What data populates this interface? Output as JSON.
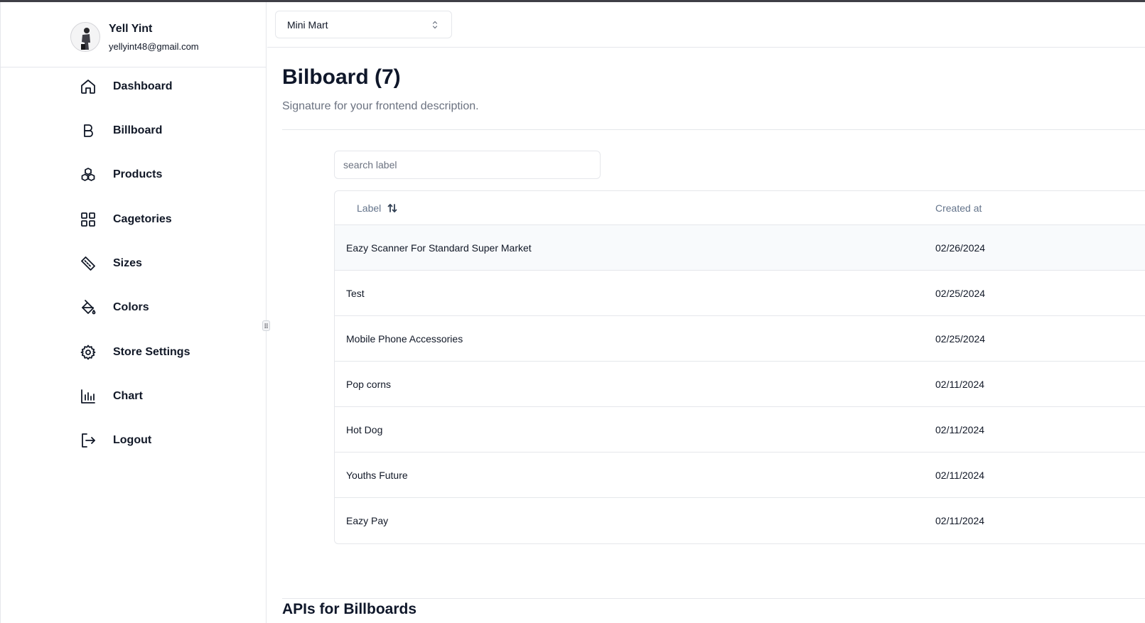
{
  "user": {
    "name": "Yell Yint",
    "email": "yellyint48@gmail.com"
  },
  "sidebar": {
    "items": [
      {
        "label": "Dashboard",
        "icon": "home-icon"
      },
      {
        "label": "Billboard",
        "icon": "bold-b-icon"
      },
      {
        "label": "Products",
        "icon": "boxes-icon"
      },
      {
        "label": "Cagetories",
        "icon": "grid-icon"
      },
      {
        "label": "Sizes",
        "icon": "ruler-icon"
      },
      {
        "label": "Colors",
        "icon": "paint-bucket-icon"
      },
      {
        "label": "Store Settings",
        "icon": "gear-icon"
      },
      {
        "label": "Chart",
        "icon": "bar-chart-icon"
      },
      {
        "label": "Logout",
        "icon": "logout-icon"
      }
    ]
  },
  "header": {
    "store": "Mini Mart"
  },
  "page": {
    "title": "Bilboard (7)",
    "description": "Signature for your frontend description."
  },
  "search": {
    "placeholder": "search label"
  },
  "table": {
    "columns": {
      "label": "Label",
      "created": "Created at"
    },
    "rows": [
      {
        "label": "Eazy Scanner For Standard Super Market",
        "created": "02/26/2024"
      },
      {
        "label": "Test",
        "created": "02/25/2024"
      },
      {
        "label": "Mobile Phone Accessories",
        "created": "02/25/2024"
      },
      {
        "label": "Pop corns",
        "created": "02/11/2024"
      },
      {
        "label": "Hot Dog",
        "created": "02/11/2024"
      },
      {
        "label": "Youths Future",
        "created": "02/11/2024"
      },
      {
        "label": "Eazy Pay",
        "created": "02/11/2024"
      }
    ]
  },
  "api": {
    "title": "APIs for Billboards"
  }
}
